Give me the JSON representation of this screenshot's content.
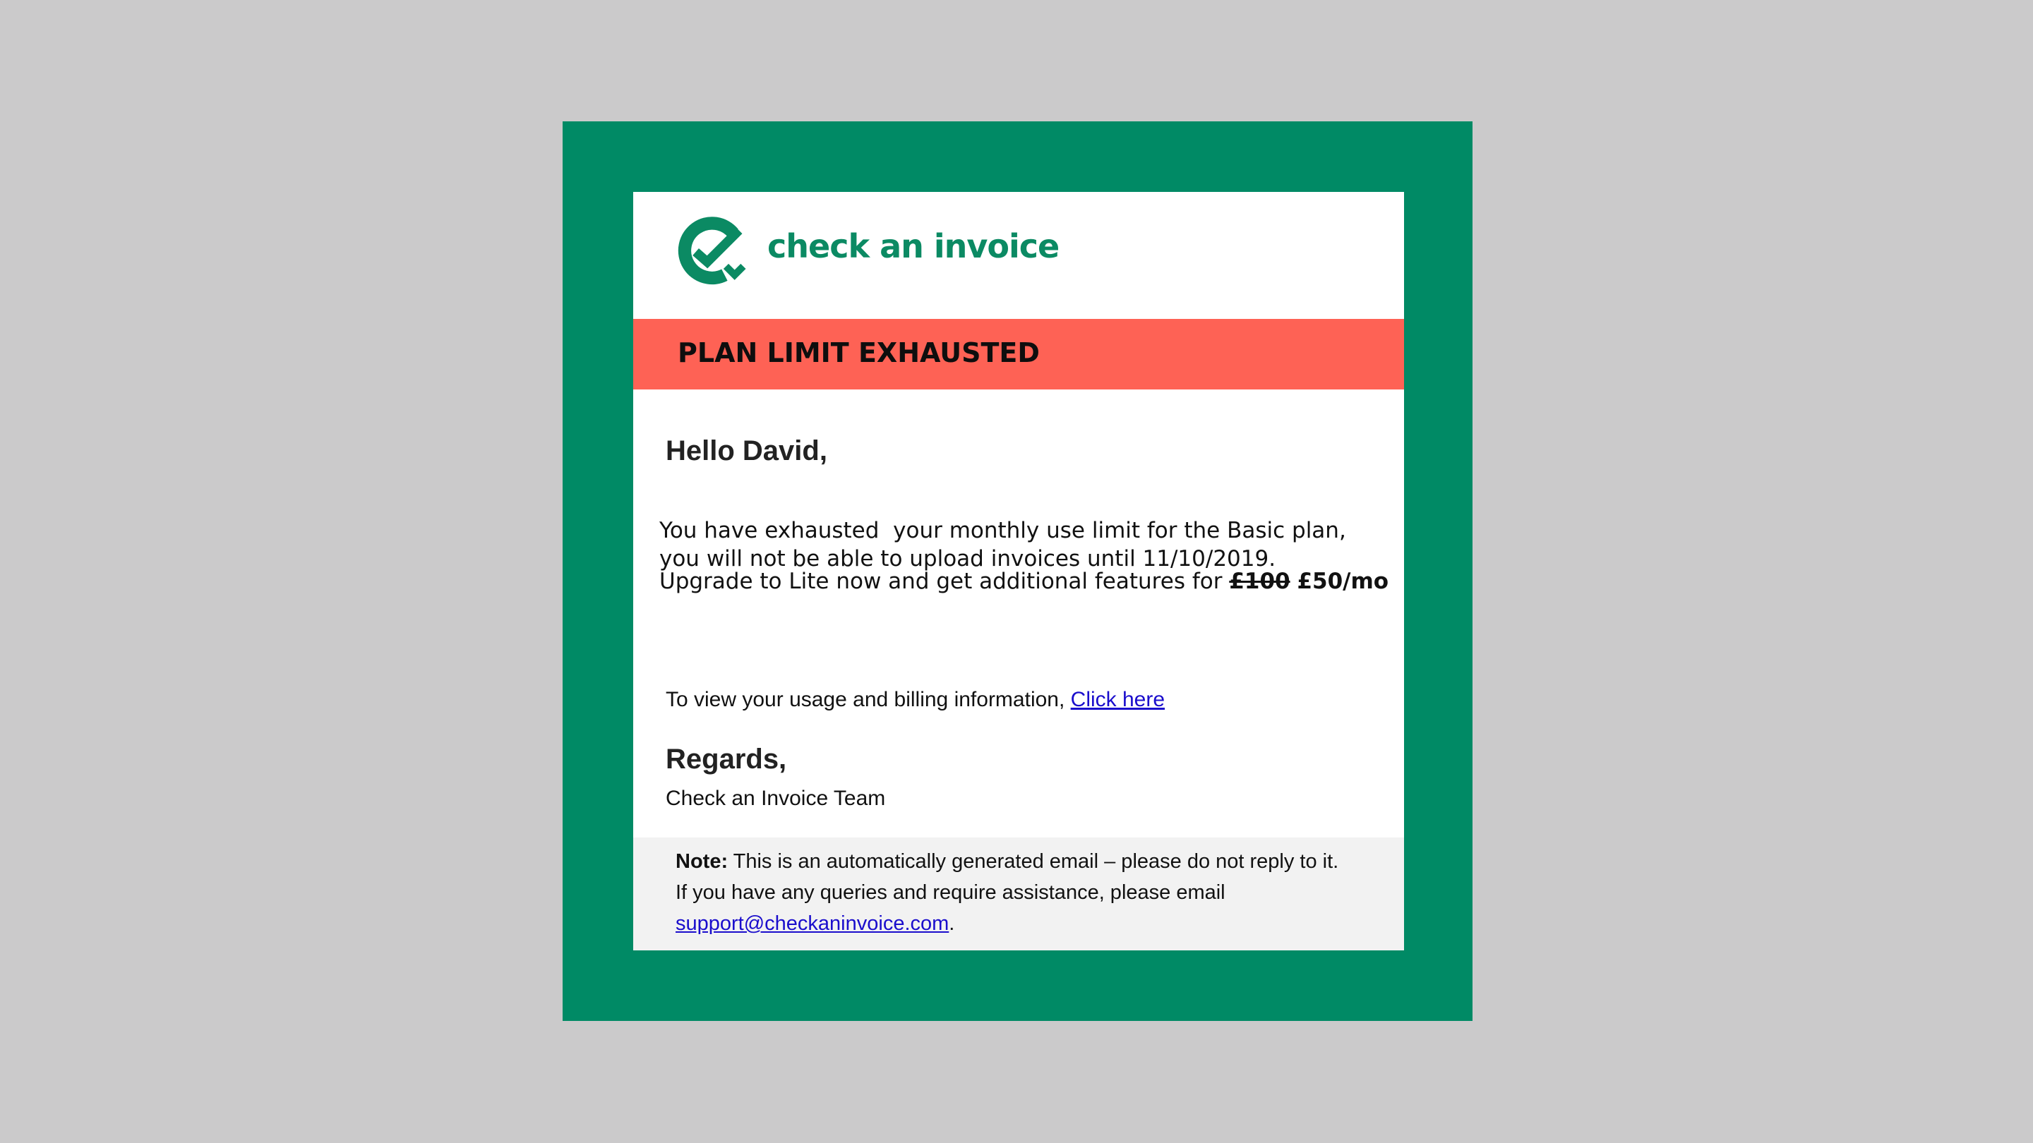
{
  "colors": {
    "background": "#cbcacb",
    "frame": "#008a65",
    "brand_green": "#0b8a63",
    "banner": "#fe6255",
    "footer": "#f2f2f2",
    "link": "#1a0dcc"
  },
  "logo": {
    "icon": "check-an-invoice-logo-icon",
    "text": "check an invoice"
  },
  "banner": {
    "title": "PLAN LIMIT EXHAUSTED"
  },
  "body": {
    "greeting": "Hello David,",
    "limit_line_1": "You have exhausted  your monthly use limit for the Basic plan,",
    "limit_line_2": "you will not be able to upload invoices until 11/10/2019.",
    "upgrade_text": "Upgrade to Lite now and get additional features for ",
    "old_price": "£100",
    "new_price": "£50/mo",
    "billing_text": "To view your usage and billing information, ",
    "billing_link": "Click here",
    "regards": "Regards,",
    "team": "Check an Invoice Team"
  },
  "footer": {
    "note_label": "Note:",
    "note_text": " This is an automatically generated email – please do not reply to it.",
    "queries_text": "If you have any queries and require assistance, please email",
    "support_email": "support@checkaninvoice.com",
    "period": "."
  }
}
